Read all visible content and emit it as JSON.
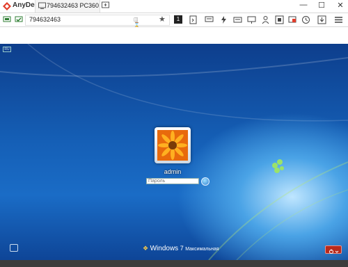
{
  "app": {
    "name": "AnyDesk"
  },
  "tab": {
    "label": "794632463  PC360"
  },
  "address": {
    "value": "794632463"
  },
  "login": {
    "username": "admin",
    "password_placeholder": "Пароль"
  },
  "branding": {
    "windows": "Windows",
    "version": "7",
    "edition": "Максимальная"
  },
  "colors": {
    "accent": "#e23d2b",
    "desktop": "#1a6cc6",
    "power": "#b82a1c"
  }
}
